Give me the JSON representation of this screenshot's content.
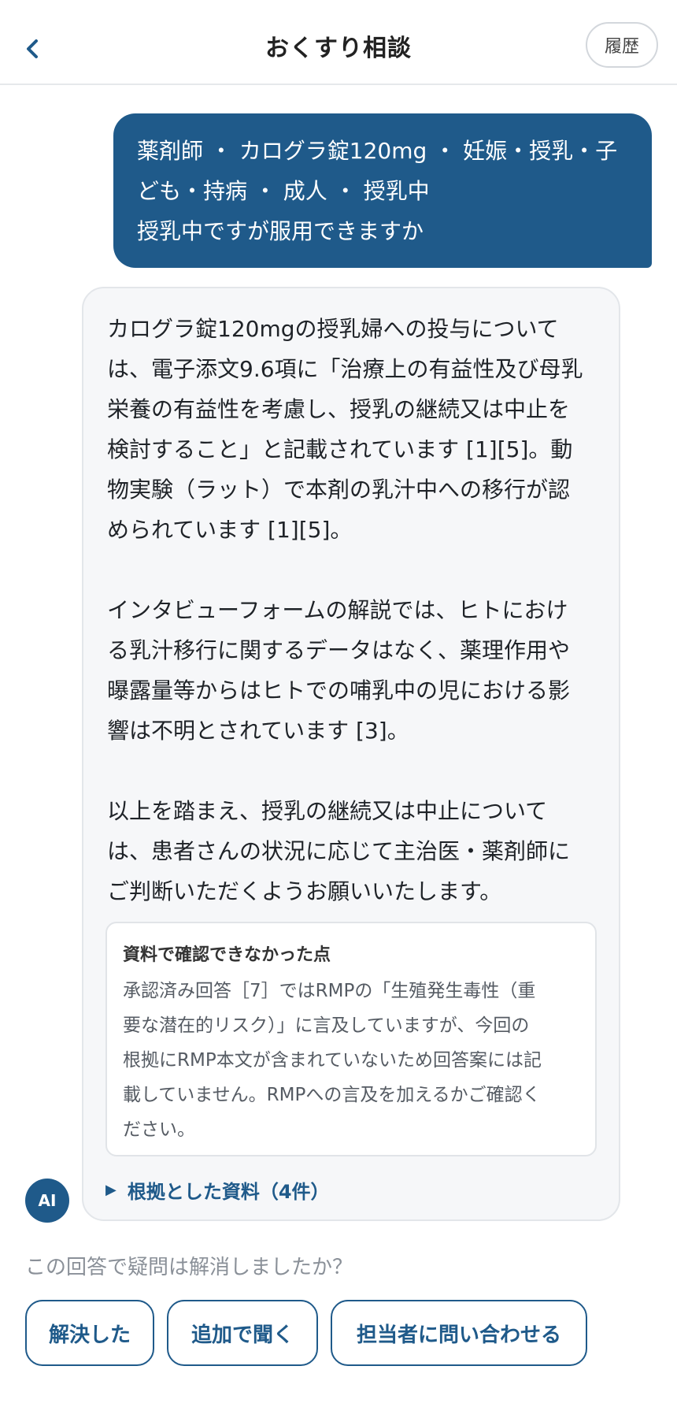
{
  "header": {
    "back_icon": "chevron-left-icon",
    "title": "おくすり相談",
    "history_label": "履歴"
  },
  "user_message": {
    "lines": [
      "薬剤師 ・ カログラ錠120mg ・ 妊娠・授乳・子",
      "ども・持病 ・ 成人 ・ 授乳中",
      "授乳中ですが服用できますか"
    ]
  },
  "ai_message": {
    "avatar_label": "AI",
    "paragraphs": [
      {
        "lines": [
          "カログラ錠120mgの授乳婦への投与について",
          "は、電子添文9.6項に「治療上の有益性及び母乳",
          "栄養の有益性を考慮し、授乳の継続又は中止を",
          "検討すること」と記載されています [1][5]。動",
          "物実験（ラット）で本剤の乳汁中への移行が認",
          "められています [1][5]。"
        ]
      },
      {
        "lines": [
          "インタビューフォームの解説では、ヒトにおけ",
          "る乳汁移行に関するデータはなく、薬理作用や",
          "曝露量等からはヒトでの哺乳中の児における影",
          "響は不明とされています [3]。"
        ]
      },
      {
        "lines": [
          "以上を踏まえ、授乳の継続又は中止について",
          "は、患者さんの状況に応じて主治医・薬剤師に",
          "ご判断いただくようお願いいたします。"
        ]
      }
    ],
    "note": {
      "title": "資料で確認できなかった点",
      "lines": [
        "承認済み回答［7］ではRMPの「生殖発生毒性（重",
        "要な潜在的リスク）」に言及していますが、今回の",
        "根拠にRMP本文が含まれていないため回答案には記",
        "載していません。RMPへの言及を加えるかご確認く",
        "ださい。"
      ]
    },
    "sources_toggle": {
      "icon": "triangle-right-icon",
      "label": "根拠とした資料（4件）"
    }
  },
  "feedback": {
    "question": "この回答で疑問は解消しましたか？",
    "buttons": {
      "resolved": "解決した",
      "ask_more": "追加で聞く",
      "contact": "担当者に問い合わせる"
    }
  },
  "colors": {
    "accent": "#1f5a8a",
    "bubble_bg": "#f6f7f9"
  }
}
